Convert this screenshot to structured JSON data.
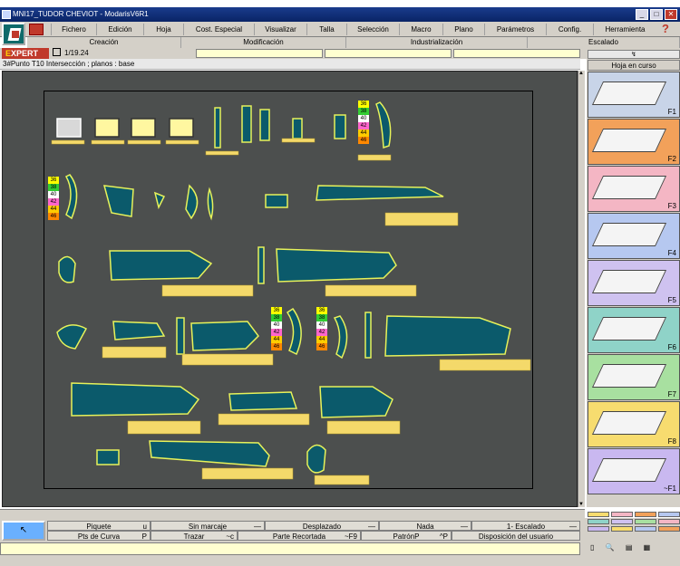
{
  "window": {
    "title": "MNI17_TUDOR CHEVIOT - ModarisV6R1",
    "controls": [
      "_",
      "□",
      "✕"
    ]
  },
  "menu": [
    {
      "label": "Fichero"
    },
    {
      "label": "Edición"
    },
    {
      "label": "Hoja"
    },
    {
      "label": "Cost. Especial"
    },
    {
      "label": "Visualizar"
    },
    {
      "label": "Talla"
    },
    {
      "label": "Selección"
    },
    {
      "label": "Macro"
    },
    {
      "label": "Plano"
    },
    {
      "label": "Parámetros"
    },
    {
      "label": "Config."
    },
    {
      "label": "Herramienta"
    }
  ],
  "help_label": "?",
  "categories": [
    {
      "label": "Creación"
    },
    {
      "label": "Modificación"
    },
    {
      "label": "Industrialización"
    },
    {
      "label": "Escalado"
    }
  ],
  "mode": {
    "ex": "E",
    "rest": "XPERT"
  },
  "version": "1/19.24",
  "status_line": "3#Punto T10 Intersección ;   planos :  base",
  "right_panel": {
    "header": "Hoja en curso",
    "tools": [
      {
        "key": "F1",
        "color": "#c8d4e8"
      },
      {
        "key": "F2",
        "color": "#f2a15a"
      },
      {
        "key": "F3",
        "color": "#f4b6c4"
      },
      {
        "key": "F4",
        "color": "#b6c8f0"
      },
      {
        "key": "F5",
        "color": "#cfc2f0"
      },
      {
        "key": "F6",
        "color": "#8fd3c8"
      },
      {
        "key": "F7",
        "color": "#a8e0a0"
      },
      {
        "key": "F8",
        "color": "#f7dc6f"
      },
      {
        "key": "~F1",
        "color": "#c9b8f0"
      }
    ]
  },
  "size_tags": [
    "36",
    "38",
    "40",
    "42",
    "44",
    "46"
  ],
  "size_colors": [
    "#ffff00",
    "#33cc33",
    "#ffffff",
    "#ff66cc",
    "#ffcc00",
    "#ff8800"
  ],
  "bottom": {
    "row1": [
      {
        "label": "Piquete",
        "key": "u"
      },
      {
        "label": "Sin marcaje",
        "key": "—"
      },
      {
        "label": "Desplazado",
        "key": "—"
      },
      {
        "label": "Nada",
        "key": "—"
      },
      {
        "label": "1- Escalado",
        "key": "—"
      }
    ],
    "row2": [
      {
        "label": "Pts de Curva",
        "key": "P"
      },
      {
        "label": "Trazar",
        "key": "~c"
      },
      {
        "label": "Parte Recortada",
        "key": "~F9"
      },
      {
        "label": "PatrónP",
        "key": "^P"
      },
      {
        "label": "Disposición del usuario",
        "key": ""
      }
    ]
  }
}
